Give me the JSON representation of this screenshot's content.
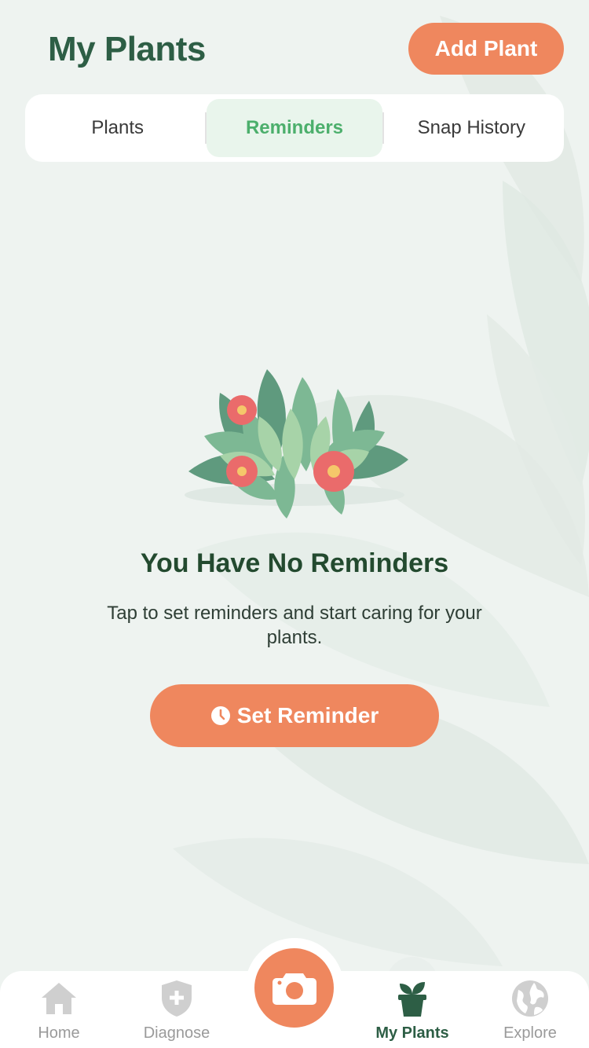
{
  "header": {
    "title": "My Plants",
    "add_plant_label": "Add Plant"
  },
  "tabs": [
    {
      "label": "Plants",
      "active": false
    },
    {
      "label": "Reminders",
      "active": true
    },
    {
      "label": "Snap History",
      "active": false
    }
  ],
  "empty_state": {
    "title": "You Have No Reminders",
    "description": "Tap to set reminders and start caring for your plants.",
    "button_label": "Set Reminder",
    "illustration": "flowering-bush-illustration"
  },
  "bottom_nav": {
    "items": [
      {
        "label": "Home",
        "icon": "home-icon",
        "active": false
      },
      {
        "label": "Diagnose",
        "icon": "shield-plus-icon",
        "active": false
      },
      {
        "label": "My Plants",
        "icon": "potted-plant-icon",
        "active": true
      },
      {
        "label": "Explore",
        "icon": "globe-icon",
        "active": false
      }
    ],
    "center_action_icon": "camera-icon"
  },
  "colors": {
    "accent": "#ef875e",
    "brand_green": "#2d5e45",
    "active_tab_text": "#4caf6c",
    "background": "#eef3f0"
  }
}
